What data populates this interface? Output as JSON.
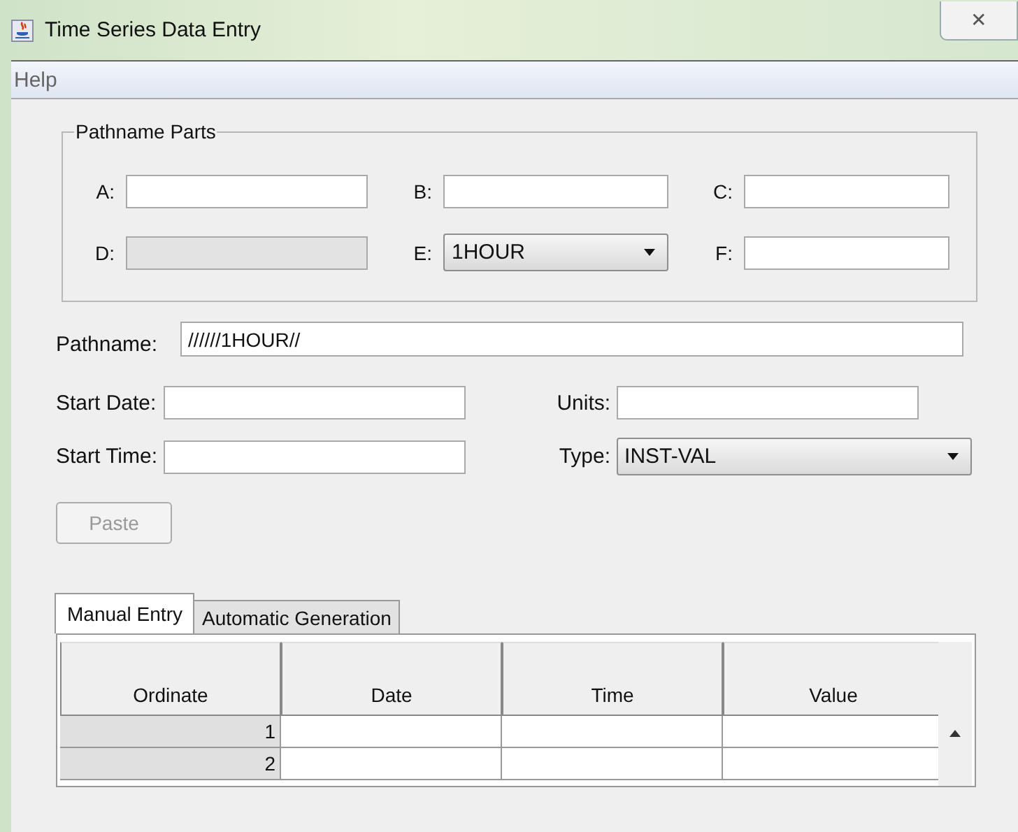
{
  "window": {
    "title": "Time Series Data Entry",
    "close": "✕"
  },
  "menu": [
    {
      "label": "Help"
    }
  ],
  "pathname_parts": {
    "title": "Pathname Parts",
    "fields": [
      {
        "label": "A:",
        "kind": "text",
        "disabled": false
      },
      {
        "label": "B:",
        "kind": "text",
        "disabled": false
      },
      {
        "label": "C:",
        "kind": "text",
        "disabled": false
      },
      {
        "label": "D:",
        "kind": "text",
        "disabled": true
      },
      {
        "label": "E:",
        "kind": "combo",
        "value": "1HOUR",
        "disabled": false
      },
      {
        "label": "F:",
        "kind": "text",
        "disabled": false
      }
    ]
  },
  "pathname": {
    "label": "Pathname:",
    "value": "//////1HOUR//"
  },
  "fields": [
    {
      "label": "Start Date:",
      "kind": "text"
    },
    {
      "label": "Units:",
      "kind": "text"
    },
    {
      "label": "Start Time:",
      "kind": "text"
    },
    {
      "label": "Type:",
      "kind": "combo",
      "value": "INST-VAL"
    }
  ],
  "paste_button": {
    "label": "Paste",
    "disabled": true
  },
  "tabs": [
    {
      "label": "Manual Entry",
      "selected": true
    },
    {
      "label": "Automatic Generation",
      "selected": false
    }
  ],
  "table": {
    "columns": [
      "Ordinate",
      "Date",
      "Time",
      "Value"
    ],
    "rows": [
      {
        "ordinate": "1"
      },
      {
        "ordinate": "2"
      }
    ]
  }
}
